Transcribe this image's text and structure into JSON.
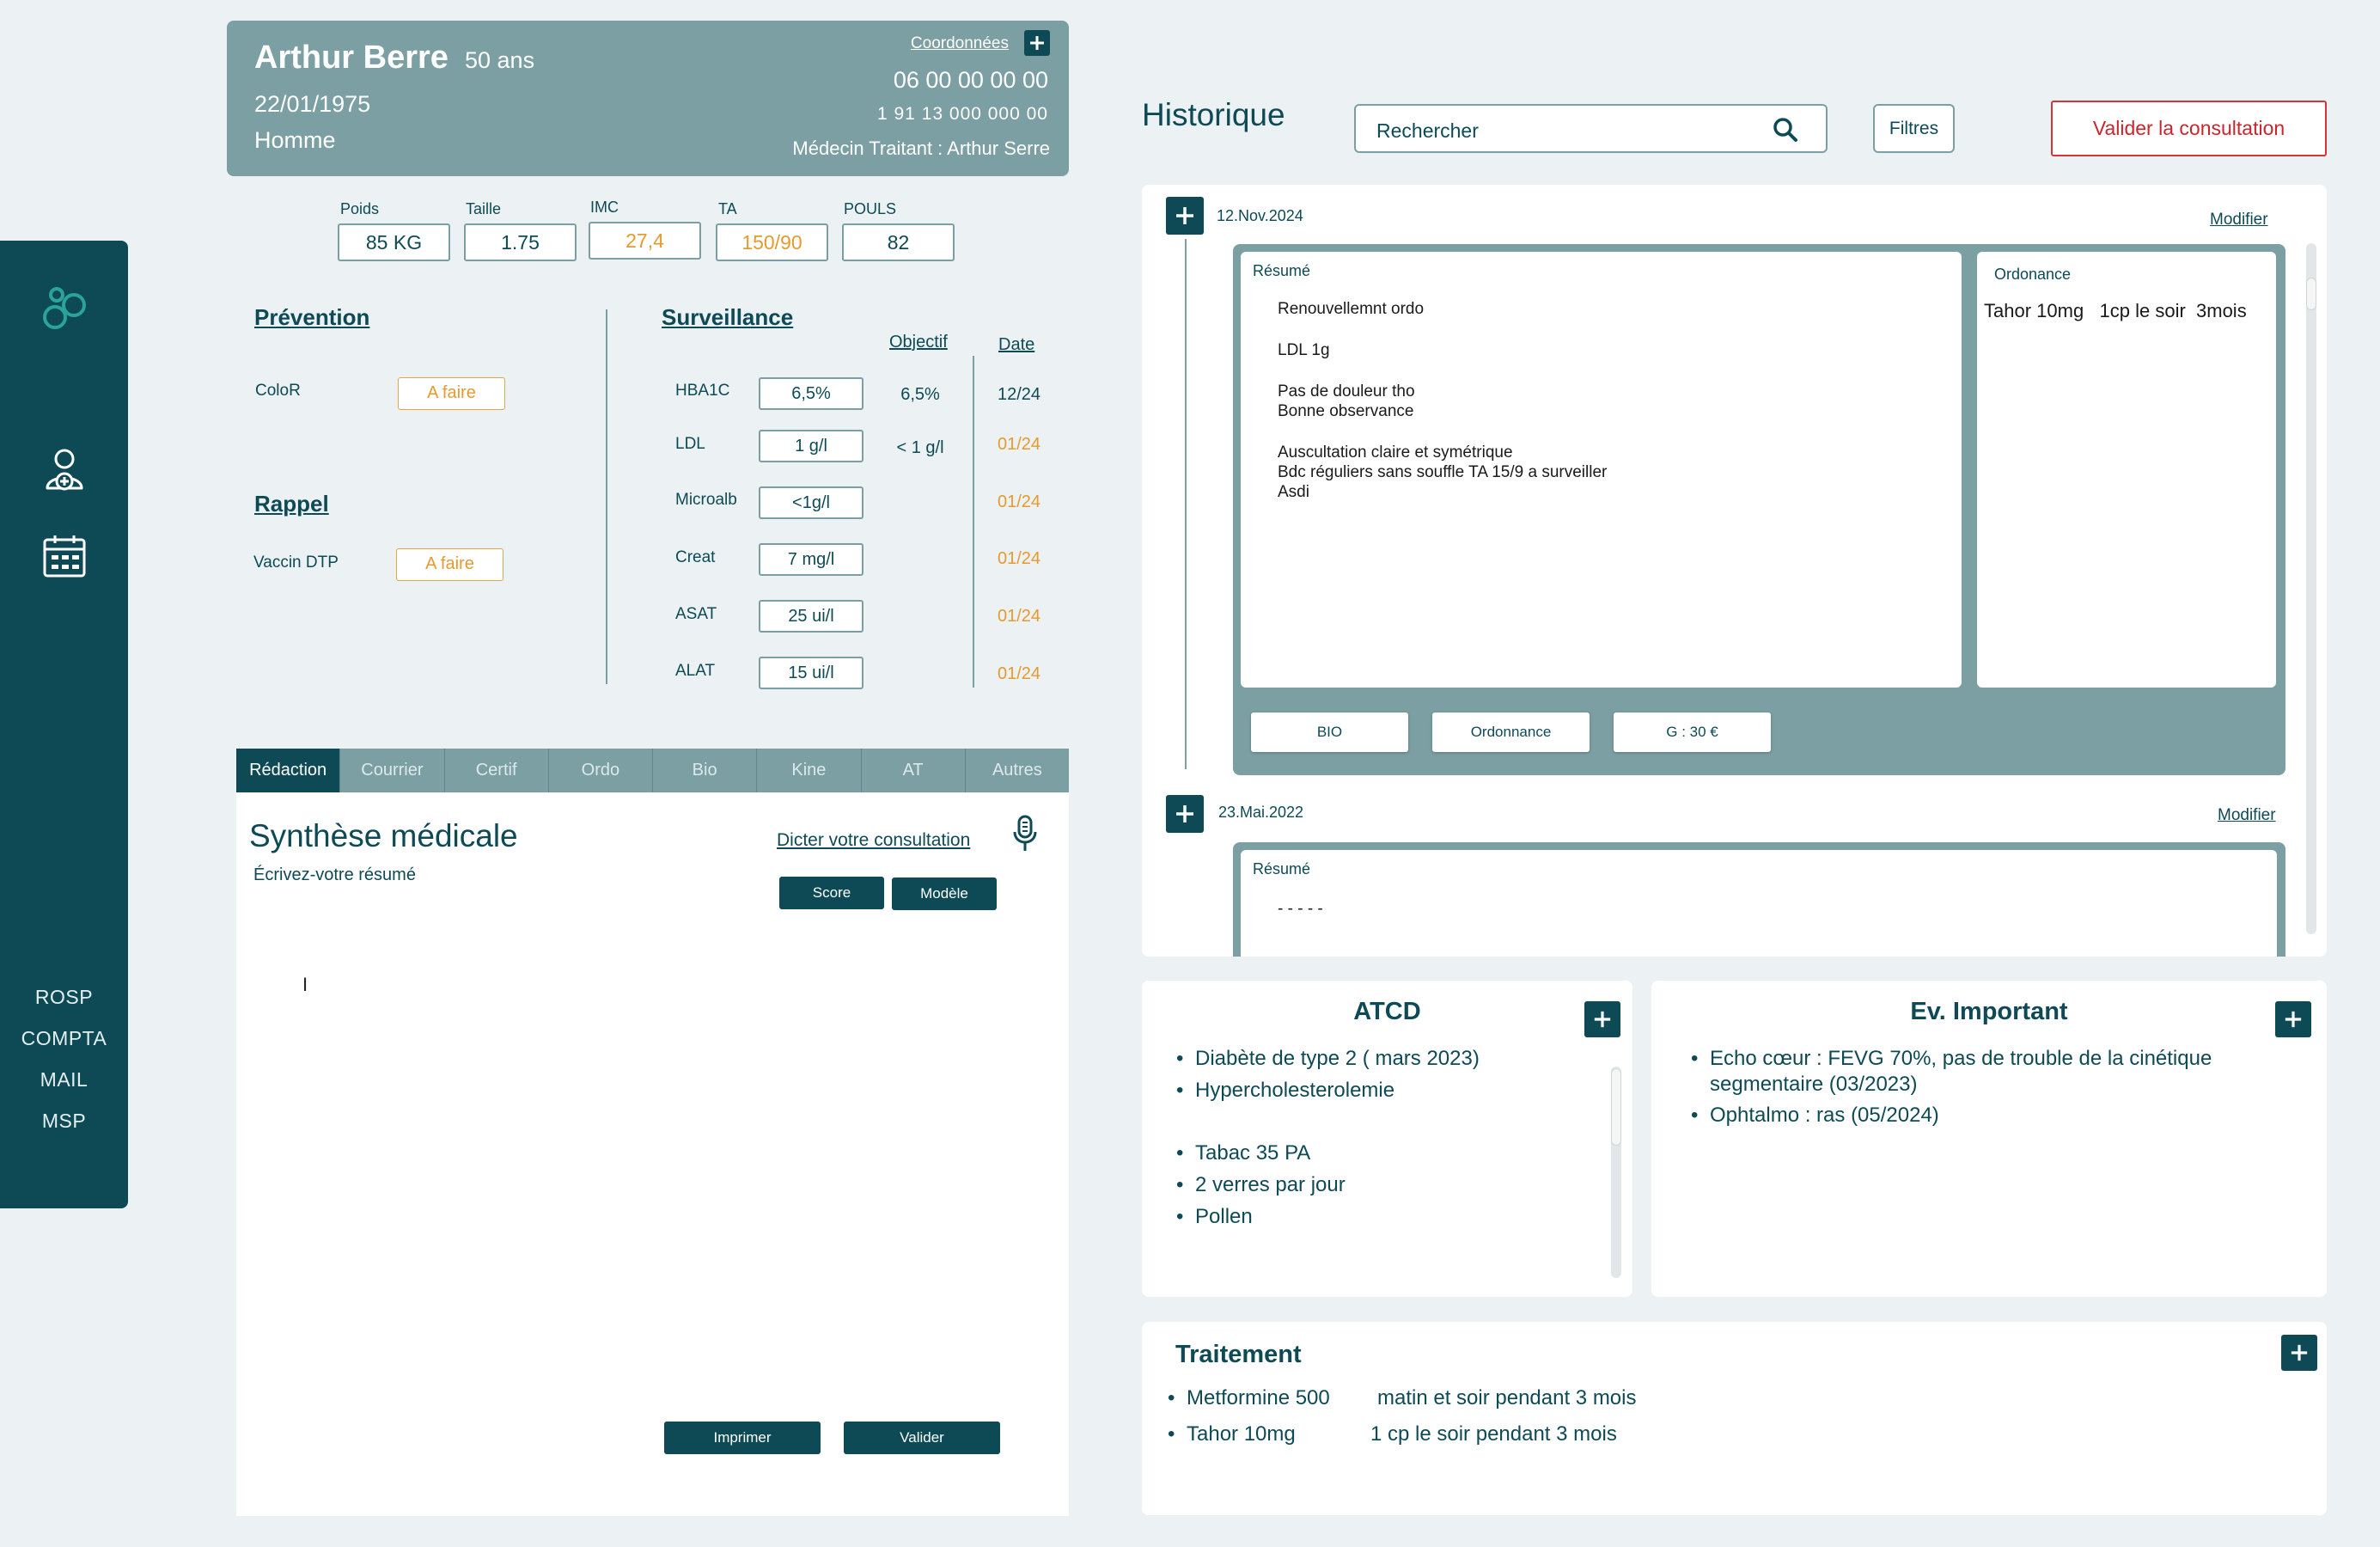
{
  "sidebar": {
    "links": [
      "ROSP",
      "COMPTA",
      "MAIL",
      "MSP"
    ]
  },
  "patient": {
    "name": "Arthur Berre",
    "age": "50 ans",
    "dob": "22/01/1975",
    "sex": "Homme",
    "coordinates_label": "Coordonnées",
    "phone": "06 00 00 00 00",
    "ssn": "1 91 13 000 000 00",
    "doctor": "Médecin Traitant : Arthur Serre"
  },
  "vitals": [
    {
      "label": "Poids",
      "value": "85 KG",
      "warn": false
    },
    {
      "label": "Taille",
      "value": "1.75",
      "warn": false
    },
    {
      "label": "IMC",
      "value": "27,4",
      "warn": true
    },
    {
      "label": "TA",
      "value": "150/90",
      "warn": true
    },
    {
      "label": "POULS",
      "value": "82",
      "warn": false
    }
  ],
  "prevention": {
    "title": "Prévention",
    "items": [
      {
        "label": "ColoR",
        "status": "A faire"
      }
    ]
  },
  "rappel": {
    "title": "Rappel",
    "items": [
      {
        "label": "Vaccin DTP",
        "status": "A faire"
      }
    ]
  },
  "surveillance": {
    "title": "Surveillance",
    "objective_header": "Objectif",
    "date_header": "Date",
    "rows": [
      {
        "label": "HBA1C",
        "value": "6,5%",
        "objective": "6,5%",
        "date": "12/24",
        "late": false
      },
      {
        "label": "LDL",
        "value": "1 g/l",
        "objective": "< 1 g/l",
        "date": "01/24",
        "late": true
      },
      {
        "label": "Microalb",
        "value": "<1g/l",
        "objective": "",
        "date": "01/24",
        "late": true
      },
      {
        "label": "Creat",
        "value": "7 mg/l",
        "objective": "",
        "date": "01/24",
        "late": true
      },
      {
        "label": "ASAT",
        "value": "25 ui/l",
        "objective": "",
        "date": "01/24",
        "late": true
      },
      {
        "label": "ALAT",
        "value": "15 ui/l",
        "objective": "",
        "date": "01/24",
        "late": true
      }
    ]
  },
  "tabs": [
    "Rédaction",
    "Courrier",
    "Certif",
    "Ordo",
    "Bio",
    "Kine",
    "AT",
    "Autres"
  ],
  "editor": {
    "title": "Synthèse médicale",
    "subtitle": "Écrivez-votre résumé",
    "dictate": "Dicter votre consultation",
    "score": "Score",
    "model": "Modèle",
    "cursor": "I",
    "print": "Imprimer",
    "validate": "Valider"
  },
  "history": {
    "title": "Historique",
    "search_placeholder": "Rechercher",
    "filters": "Filtres",
    "validate_consultation": "Valider la consultation",
    "entries": [
      {
        "date": "12.Nov.2024",
        "modify": "Modifier",
        "summary_label": "Résumé",
        "summary_lines": [
          "Renouvellemnt ordo",
          "LDL 1g",
          "Pas de douleur tho",
          "Bonne observance",
          "Auscultation claire et symétrique",
          "Bdc réguliers sans souffle TA 15/9 a surveiller",
          "Asdi"
        ],
        "ordonnance_label": "Ordonance",
        "ordonnance_text": "Tahor 10mg   1cp le soir  3mois",
        "buttons": [
          "BIO",
          "Ordonnance",
          "G : 30 €"
        ]
      },
      {
        "date": "23.Mai.2022",
        "modify": "Modifier",
        "summary_label": "Résumé",
        "summary_lines": [
          "- - - - -"
        ]
      }
    ]
  },
  "atcd": {
    "title": "ATCD",
    "group1": [
      "Diabète de type 2 ( mars 2023)",
      "Hypercholesterolemie"
    ],
    "group2": [
      "Tabac 35 PA",
      "2 verres par jour",
      "Pollen"
    ]
  },
  "ev_important": {
    "title": "Ev. Important",
    "items": [
      "Echo cœur : FEVG 70%, pas de trouble de la cinétique segmentaire (03/2023)",
      "Ophtalmo : ras (05/2024)"
    ]
  },
  "traitement": {
    "title": "Traitement",
    "items": [
      {
        "drug": "Metformine 500",
        "posology": "matin et soir pendant 3 mois"
      },
      {
        "drug": "Tahor 10mg",
        "posology": "1 cp le soir pendant 3 mois"
      }
    ]
  },
  "colors": {
    "primary": "#0d4a55",
    "muted": "#7b9fa3",
    "warning": "#e69a2e",
    "danger": "#c9252c",
    "background": "#ecf1f3"
  }
}
